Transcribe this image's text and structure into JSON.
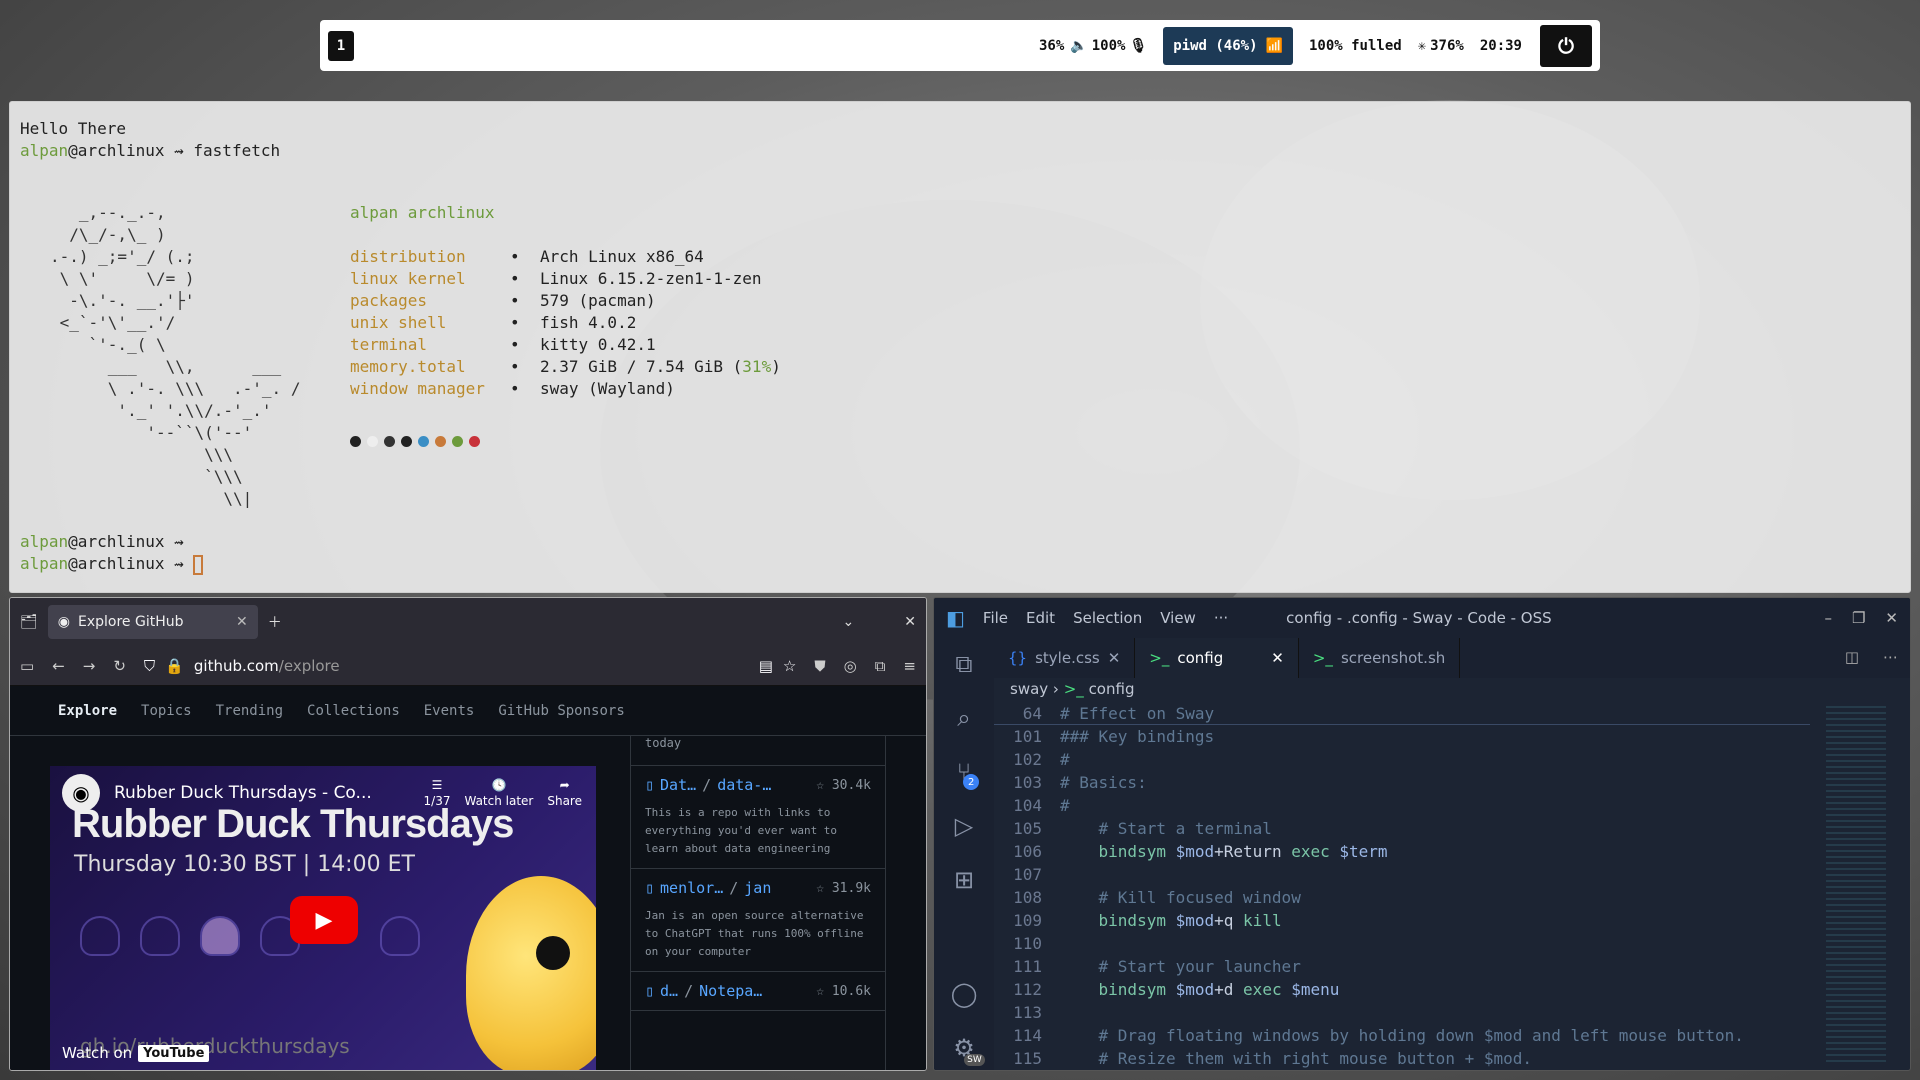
{
  "bar": {
    "workspace": "1",
    "brightness": "36%",
    "volume": "100%",
    "network": "piwd (46%)",
    "battery": "100% fulled",
    "cpu": "376%",
    "time": "20:39"
  },
  "terminal": {
    "greeting": "Hello There",
    "user": "alpan",
    "host": "@archlinux",
    "arrow": " ⇝ ",
    "cmd": "fastfetch",
    "info_header": "alpan archlinux",
    "info": [
      {
        "k": "distribution",
        "v": "Arch Linux x86_64"
      },
      {
        "k": "linux kernel",
        "v": "Linux 6.15.2-zen1-1-zen"
      },
      {
        "k": "packages",
        "v": "579 (pacman)"
      },
      {
        "k": "unix shell",
        "v": "fish 4.0.2"
      },
      {
        "k": "terminal",
        "v": "kitty 0.42.1"
      },
      {
        "k": "memory.total",
        "v": "2.37 GiB / 7.54 GiB (",
        "pct": "31%",
        "tail": ")"
      },
      {
        "k": "window manager",
        "v": "sway (Wayland)"
      }
    ],
    "bullet": "•",
    "colors": [
      "#222222",
      "#eeeeee",
      "#333333",
      "#222222",
      "#3a8ec5",
      "#c87a3a",
      "#6d9b3c",
      "#c8323a"
    ],
    "ascii": "   _,--._.-,\n  /\\_/-,\\_ )\n.-.) _;='_/ (.;\n \\ \\'     \\/= )\n  -\\.'-. __.'├'\n <_`-'\\'__.'/\n    `'-._( \\\n      ___   \\\\,      ___\n      \\ .'-. \\\\\\   .-'_. /\n       '._' '.\\\\/.-'_.'\n          '--``\\('--'\n                \\\\\\\n                `\\\\\\\n                  \\\\|"
  },
  "browser": {
    "tab": "Explore GitHub",
    "url_host": "github.com",
    "url_path": "/explore",
    "nav": [
      "Explore",
      "Topics",
      "Trending",
      "Collections",
      "Events",
      "GitHub Sponsors"
    ],
    "video": {
      "title": "Rubber Duck Thursdays",
      "channel": "Rubber Duck Thursdays - Co...",
      "subtitle": "Thursday 10:30 BST | 14:00 ET",
      "watch": "Watch on",
      "yt": "YouTube",
      "url": "gh.io/rubberduckthursdays",
      "btn1": "1/37",
      "btn2": "Watch later",
      "btn3": "Share"
    },
    "repos": [
      {
        "owner": "Dat…",
        "name": "data-…",
        "stars": "30.4k",
        "desc": "This is a repo with links to everything you'd ever want to learn about data engineering"
      },
      {
        "owner": "menlor…",
        "name": "jan",
        "stars": "31.9k",
        "desc": "Jan is an open source alternative to ChatGPT that runs 100% offline on your computer"
      },
      {
        "owner": "d…",
        "name": "Notepa…",
        "stars": "10.6k",
        "desc": ""
      }
    ],
    "today": "today"
  },
  "code": {
    "menu": [
      "File",
      "Edit",
      "Selection",
      "View",
      "···"
    ],
    "title": "config - .config - Sway - Code - OSS",
    "tabs": [
      "style.css",
      "config",
      "screenshot.sh"
    ],
    "crumb1": "sway",
    "crumb2": "config",
    "badge": "2",
    "sw": "SW",
    "lines": [
      {
        "n": "64",
        "c": "# Effect on Sway",
        "t": "cmt"
      },
      {
        "n": "101",
        "c": "### Key bindings",
        "t": "cmt"
      },
      {
        "n": "102",
        "c": "#",
        "t": "cmt"
      },
      {
        "n": "103",
        "c": "# Basics:",
        "t": "cmt"
      },
      {
        "n": "104",
        "c": "#",
        "t": "cmt"
      },
      {
        "n": "105",
        "c": "    # Start a terminal",
        "t": "cmt"
      },
      {
        "n": "106",
        "c": "    bindsym $mod+Return exec $term",
        "t": "code"
      },
      {
        "n": "107",
        "c": "",
        "t": "code"
      },
      {
        "n": "108",
        "c": "    # Kill focused window",
        "t": "cmt"
      },
      {
        "n": "109",
        "c": "    bindsym $mod+q kill",
        "t": "code"
      },
      {
        "n": "110",
        "c": "",
        "t": "code"
      },
      {
        "n": "111",
        "c": "    # Start your launcher",
        "t": "cmt"
      },
      {
        "n": "112",
        "c": "    bindsym $mod+d exec $menu",
        "t": "code"
      },
      {
        "n": "113",
        "c": "",
        "t": "code"
      },
      {
        "n": "114",
        "c": "    # Drag floating windows by holding down $mod and left mouse button.",
        "t": "cmt"
      },
      {
        "n": "115",
        "c": "    # Resize them with right mouse button + $mod.",
        "t": "cmt"
      }
    ]
  }
}
